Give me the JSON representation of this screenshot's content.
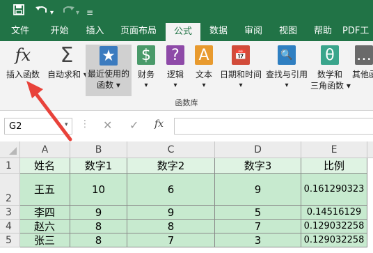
{
  "qat": {
    "save_icon": "save-icon",
    "undo_icon": "undo-icon",
    "redo_icon": "redo-icon",
    "customize_icon": "customize-qat-icon"
  },
  "tabs": [
    "文件",
    "开始",
    "插入",
    "页面布局",
    "公式",
    "数据",
    "审阅",
    "视图",
    "帮助",
    "PDF工"
  ],
  "active_tab": "公式",
  "ribbon": {
    "buttons": [
      {
        "icon_text": "fx",
        "label": "插入函数",
        "label2": ""
      },
      {
        "icon_text": "Σ",
        "label": "自动求和",
        "label2": ""
      },
      {
        "icon_text": "★",
        "label": "最近使用的",
        "label2": "函数"
      },
      {
        "icon_text": "$",
        "label": "财务",
        "label2": ""
      },
      {
        "icon_text": "?",
        "label": "逻辑",
        "label2": ""
      },
      {
        "icon_text": "A",
        "label": "文本",
        "label2": ""
      },
      {
        "icon_text": "📅",
        "label": "日期和时间",
        "label2": ""
      },
      {
        "icon_text": "🔍",
        "label": "查找与引用",
        "label2": ""
      },
      {
        "icon_text": "θ",
        "label": "数学和",
        "label2": "三角函数"
      },
      {
        "icon_text": "…",
        "label": "其他函",
        "label2": ""
      }
    ],
    "group_label": "函数库"
  },
  "formula_bar": {
    "name_box": "G2",
    "fx": "fx",
    "value": ""
  },
  "grid": {
    "columns": [
      "A",
      "B",
      "C",
      "D",
      "E"
    ],
    "rows": [
      {
        "num": "1",
        "cells": [
          "姓名",
          "数字1",
          "数字2",
          "数字3",
          "比例"
        ]
      },
      {
        "num": "2",
        "cells": [
          "王五",
          "10",
          "6",
          "9",
          "0.161290323"
        ]
      },
      {
        "num": "3",
        "cells": [
          "李四",
          "9",
          "9",
          "5",
          "0.14516129"
        ]
      },
      {
        "num": "4",
        "cells": [
          "赵六",
          "8",
          "8",
          "7",
          "0.129032258"
        ]
      },
      {
        "num": "5",
        "cells": [
          "张三",
          "8",
          "7",
          "3",
          "0.129032258"
        ]
      }
    ]
  },
  "colors": {
    "excel_green": "#217346",
    "cell_fill": "#c7eacf",
    "arrow": "#e8423a"
  }
}
